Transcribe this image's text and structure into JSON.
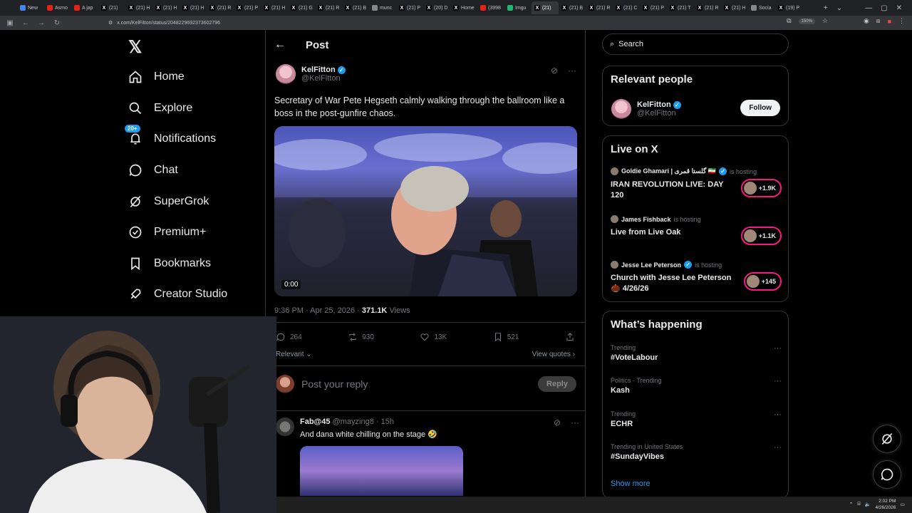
{
  "browser": {
    "tabs": [
      {
        "label": "New",
        "icon": "chrome-icon"
      },
      {
        "label": "Asmo",
        "icon": "youtube-icon"
      },
      {
        "label": "A jap",
        "icon": "youtube-icon"
      },
      {
        "label": "(21)",
        "icon": "x-icon"
      },
      {
        "label": "(21) H",
        "icon": "x-icon"
      },
      {
        "label": "(21) H",
        "icon": "x-icon"
      },
      {
        "label": "(21) H",
        "icon": "x-icon"
      },
      {
        "label": "(21) R",
        "icon": "x-icon"
      },
      {
        "label": "(21) P",
        "icon": "x-icon"
      },
      {
        "label": "(21) H",
        "icon": "x-icon"
      },
      {
        "label": "(21) G",
        "icon": "x-icon"
      },
      {
        "label": "(21) R",
        "icon": "x-icon"
      },
      {
        "label": "(21) B",
        "icon": "x-icon"
      },
      {
        "label": "munc",
        "icon": "globe-icon"
      },
      {
        "label": "(21) P",
        "icon": "x-icon"
      },
      {
        "label": "(20) D",
        "icon": "x-icon"
      },
      {
        "label": "Home",
        "icon": "x-icon"
      },
      {
        "label": "(3998",
        "icon": "youtube-icon"
      },
      {
        "label": "Imgu",
        "icon": "imgur-icon"
      },
      {
        "label": "(21)",
        "icon": "x-icon"
      },
      {
        "label": "(21) B",
        "icon": "x-icon"
      },
      {
        "label": "(21) R",
        "icon": "x-icon"
      },
      {
        "label": "(21) C",
        "icon": "x-icon"
      },
      {
        "label": "(21) P",
        "icon": "x-icon"
      },
      {
        "label": "(21) T",
        "icon": "x-icon"
      },
      {
        "label": "(21) R",
        "icon": "x-icon"
      },
      {
        "label": "(21) H",
        "icon": "x-icon"
      },
      {
        "label": "Socia",
        "icon": "globe-icon"
      },
      {
        "label": "(19) P",
        "icon": "x-icon"
      }
    ],
    "url": "x.com/KelFitton/status/2048229692373602796",
    "zoom": "150%"
  },
  "nav": {
    "logo": "𝕏",
    "items": [
      {
        "label": "Home",
        "icon": "home-icon"
      },
      {
        "label": "Explore",
        "icon": "search-icon"
      },
      {
        "label": "Notifications",
        "icon": "bell-icon",
        "badge": "20+"
      },
      {
        "label": "Chat",
        "icon": "chat-icon"
      },
      {
        "label": "SuperGrok",
        "icon": "grok-icon"
      },
      {
        "label": "Premium+",
        "icon": "verified-icon"
      },
      {
        "label": "Bookmarks",
        "icon": "bookmark-icon"
      },
      {
        "label": "Creator Studio",
        "icon": "rocket-icon"
      }
    ]
  },
  "post": {
    "header": "Post",
    "author_name": "KelFitton",
    "author_handle": "@KelFitton",
    "text": "Secretary of War Pete Hegseth calmly walking through the ballroom like a boss in the post-gunfire chaos.",
    "video_time": "0:00",
    "time": "9:36 PM · Apr 25, 2026 · ",
    "views_count": "371.1K",
    "views_label": " Views",
    "replies": "264",
    "reposts": "930",
    "likes": "13K",
    "bookmarks": "521",
    "sort": "Relevant",
    "view_quotes": "View quotes",
    "reply_placeholder": "Post your reply",
    "reply_button": "Reply"
  },
  "reply": {
    "name": "Fab@45",
    "handle": "@mayzing8",
    "age": "15h",
    "text": "And dana white chilling on the stage 🤣"
  },
  "sidebar": {
    "search_placeholder": "Search",
    "relevant_title": "Relevant people",
    "relevant_name": "KelFitton",
    "relevant_handle": "@KelFitton",
    "follow_label": "Follow",
    "live_title": "Live on X",
    "live": [
      {
        "host": "Goldie Ghamari | گلستا قمری 🇮🇷",
        "status": "is hosting",
        "title": "IRAN REVOLUTION LIVE: DAY 120",
        "count": "+1.9K"
      },
      {
        "host": "James Fishback",
        "status": "is hosting",
        "title": "Live from Live Oak",
        "count": "+1.1K"
      },
      {
        "host": "Jesse Lee Peterson",
        "status": "is hosting",
        "title": "Church with Jesse Lee Peterson 🌰 4/26/26",
        "count": "+145"
      }
    ],
    "happening_title": "What’s happening",
    "trends": [
      {
        "category": "Trending",
        "topic": "#VoteLabour"
      },
      {
        "category": "Politics · Trending",
        "topic": "Kash"
      },
      {
        "category": "Trending",
        "topic": "ECHR"
      },
      {
        "category": "Trending in United States",
        "topic": "#SundayVibes"
      }
    ],
    "show_more": "Show more"
  },
  "taskbar": {
    "time": "2:02 PM",
    "date": "4/26/2026"
  },
  "colors": {
    "accent": "#1d9bf0",
    "live_ring": "#f91880",
    "background": "#000000",
    "border": "#2f3336"
  }
}
